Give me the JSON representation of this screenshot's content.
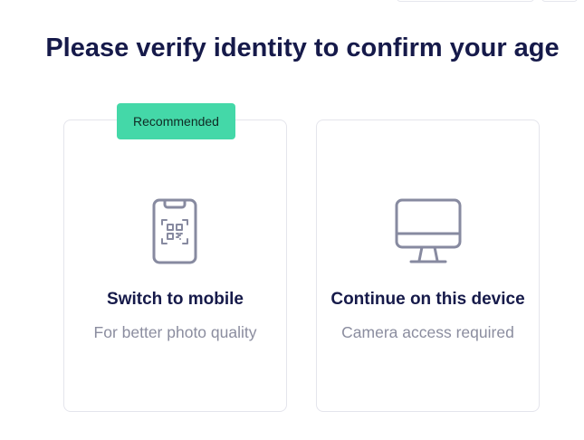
{
  "page": {
    "title": "Please verify identity to confirm your age"
  },
  "options": [
    {
      "badge": "Recommended",
      "title": "Switch to mobile",
      "subtitle": "For better photo quality",
      "icon": "mobile-qr-icon"
    },
    {
      "title": "Continue on this device",
      "subtitle": "Camera access required",
      "icon": "desktop-monitor-icon"
    }
  ],
  "colors": {
    "heading": "#161a4a",
    "muted": "#8b8d9f",
    "icon": "#878aa0",
    "badge_bg": "#44d8a8",
    "card_border": "#e4e5ec"
  }
}
